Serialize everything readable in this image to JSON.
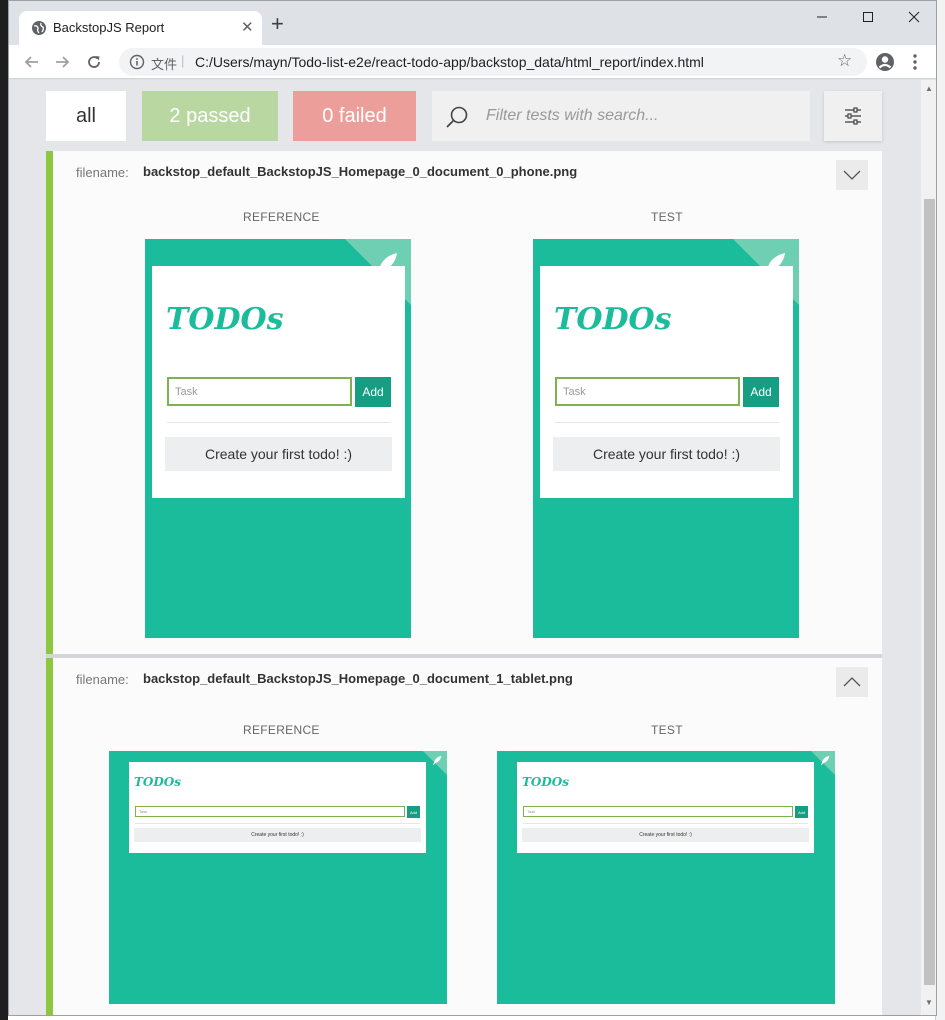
{
  "browser": {
    "tab_title": "BackstopJS Report",
    "tab_close": "✕",
    "new_tab": "+",
    "scheme_label": "文件",
    "separator": "|",
    "url": "C:/Users/mayn/Todo-list-e2e/react-todo-app/backstop_data/html_report/index.html",
    "star": "☆"
  },
  "toolbar": {
    "all_label": "all",
    "passed_label": "2 passed",
    "failed_label": "0 failed",
    "search_placeholder": "Filter tests with search..."
  },
  "tests": [
    {
      "filename_label": "filename:",
      "filename": "backstop_default_BackstopJS_Homepage_0_document_0_phone.png",
      "reference_label": "REFERENCE",
      "test_label": "TEST",
      "screenshot": {
        "brand": "TODOs",
        "input_placeholder": "Task",
        "add_label": "Add",
        "empty_message": "Create your first todo! :)"
      }
    },
    {
      "filename_label": "filename:",
      "filename": "backstop_default_BackstopJS_Homepage_0_document_1_tablet.png",
      "reference_label": "REFERENCE",
      "test_label": "TEST",
      "screenshot": {
        "brand": "TODOs",
        "input_placeholder": "Task",
        "add_label": "Add",
        "empty_message": "Create your first todo! :)"
      }
    }
  ],
  "colors": {
    "passed": "#b9d7a0",
    "failed": "#ec9f9a",
    "card_border": "#8dc63f",
    "todo_teal": "#1bbc9b",
    "add_button": "#169e83"
  }
}
